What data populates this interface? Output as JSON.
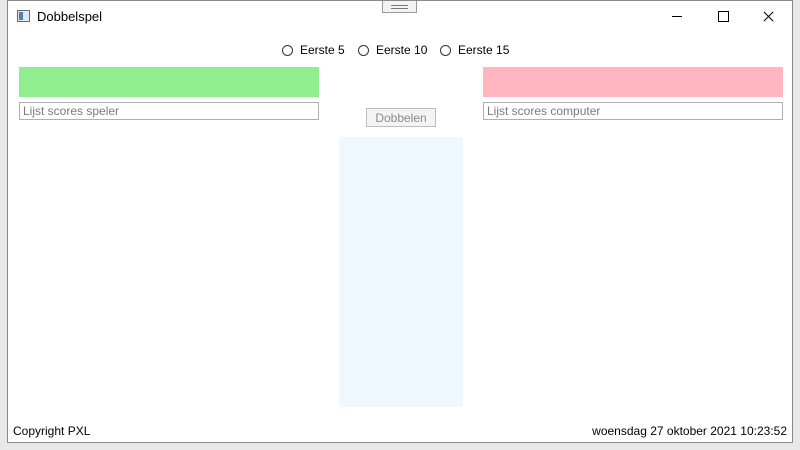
{
  "window": {
    "title": "Dobbelspel"
  },
  "icons": {
    "app": "app-window-icon",
    "minimize": "minimize-icon",
    "maximize": "maximize-icon",
    "close": "close-icon",
    "grip": "drag-grip-icon"
  },
  "mode_options": [
    {
      "label": "Eerste 5",
      "selected": false
    },
    {
      "label": "Eerste 10",
      "selected": false
    },
    {
      "label": "Eerste 15",
      "selected": false
    }
  ],
  "player": {
    "color": "#90ee90",
    "scores_placeholder": "Lijst scores speler"
  },
  "computer": {
    "color": "#ffb6c1",
    "scores_placeholder": "Lijst scores computer"
  },
  "dice_area": {
    "color": "#f0f8ff"
  },
  "roll_button": {
    "label": "Dobbelen",
    "enabled": false
  },
  "footer": {
    "copyright": "Copyright PXL",
    "datetime": "woensdag 27 oktober 2021 10:23:52"
  }
}
